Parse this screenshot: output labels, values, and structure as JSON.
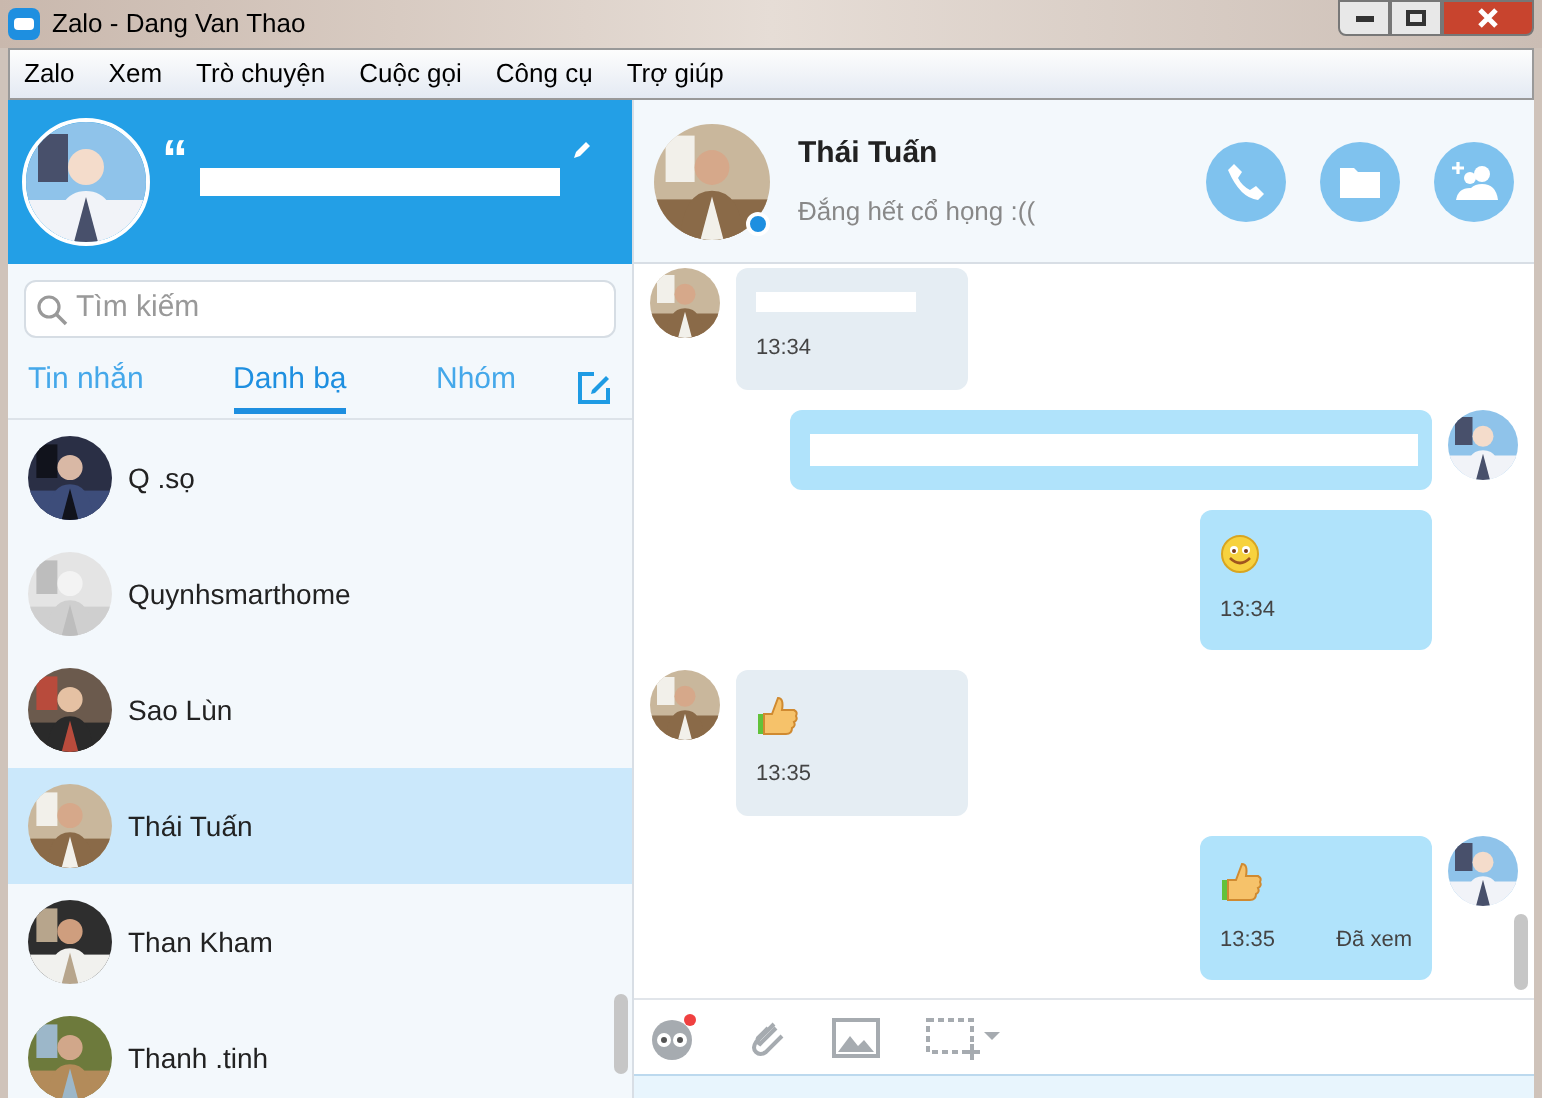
{
  "window": {
    "title": "Zalo - Dang Van Thao"
  },
  "menu": [
    "Zalo",
    "Xem",
    "Trò chuyện",
    "Cuộc gọi",
    "Công cụ",
    "Trợ giúp"
  ],
  "profile": {
    "quote_mark": "“"
  },
  "search": {
    "placeholder": "Tìm kiếm"
  },
  "tabs": [
    {
      "label": "Tin nhắn",
      "selected": false
    },
    {
      "label": "Danh bạ",
      "selected": true
    },
    {
      "label": "Nhóm",
      "selected": false
    }
  ],
  "contacts": [
    {
      "name": "Q .sọ",
      "selected": false
    },
    {
      "name": "Quynhsmarthome",
      "selected": false
    },
    {
      "name": "Sao Lùn",
      "selected": false
    },
    {
      "name": "Thái Tuấn",
      "selected": true
    },
    {
      "name": "Than Kham",
      "selected": false
    },
    {
      "name": "Thanh .tinh",
      "selected": false
    }
  ],
  "conversation": {
    "name": "Thái Tuấn",
    "status": "Đắng hết cổ họng :((",
    "online": true
  },
  "messages": [
    {
      "outgoing": false,
      "avatar": true,
      "kind": "redacted",
      "time": "13:34"
    },
    {
      "outgoing": true,
      "avatar": true,
      "kind": "redacted_wide"
    },
    {
      "outgoing": true,
      "avatar": false,
      "kind": "smiley",
      "time": "13:34"
    },
    {
      "outgoing": false,
      "avatar": true,
      "kind": "thumbs_up",
      "time": "13:35"
    },
    {
      "outgoing": true,
      "avatar": true,
      "kind": "thumbs_up",
      "time": "13:35",
      "receipt": "Đã xem"
    }
  ]
}
